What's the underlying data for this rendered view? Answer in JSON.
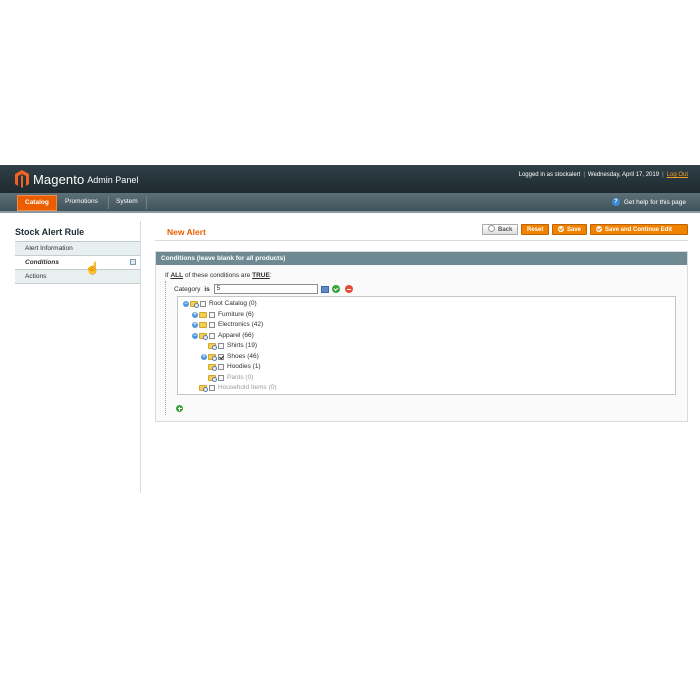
{
  "header": {
    "brand": "Magento",
    "subtitle": "Admin Panel",
    "logged_in": "Logged in as stockalert",
    "date": "Wednesday, April 17, 2019",
    "logout": "Log Out"
  },
  "nav": {
    "items": [
      {
        "label": "Catalog",
        "active": true
      },
      {
        "label": "Promotions",
        "active": false
      },
      {
        "label": "System",
        "active": false
      }
    ],
    "help": "Get help for this page"
  },
  "sidebar": {
    "title": "Stock Alert Rule",
    "tabs": [
      {
        "label": "Alert Information"
      },
      {
        "label": "Conditions"
      },
      {
        "label": "Actions"
      }
    ]
  },
  "content": {
    "title": "New Alert",
    "buttons": {
      "back": "Back",
      "reset": "Reset",
      "save": "Save",
      "save_continue": "Save and Continue Edit"
    }
  },
  "conditions": {
    "header": "Conditions (leave blank for all products)",
    "if_text": "If",
    "aggregator": "ALL",
    "middle_text": "of these conditions are",
    "value": "TRUE",
    "colon": ":",
    "attribute": "Category",
    "operator": "is",
    "input_value": "5"
  },
  "tree": [
    {
      "label": "Root Catalog (0)"
    },
    {
      "label": "Furniture (6)"
    },
    {
      "label": "Electronics (42)"
    },
    {
      "label": "Apparel (66)"
    },
    {
      "label": "Shirts (19)"
    },
    {
      "label": "Shoes (46)"
    },
    {
      "label": "Hoodies (1)"
    },
    {
      "label": "Pants (0)"
    },
    {
      "label": "Household Items (0)"
    }
  ],
  "colors": {
    "accent": "#eb5e00",
    "button": "#f18200",
    "header": "#2f4047",
    "section_header": "#6f8992"
  }
}
